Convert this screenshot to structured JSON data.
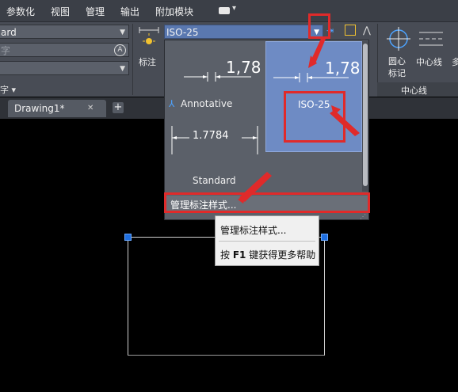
{
  "menubar": {
    "items": [
      "参数化",
      "视图",
      "管理",
      "输出",
      "附加模块"
    ],
    "extra_icon": "video-icon",
    "extra_arrow": "▾"
  },
  "ribbon": {
    "text_style_value": "ard",
    "text_height_placeholder": "字",
    "text_panel_label": "字 ▾",
    "dim_button_label": "标注",
    "dim_style_value": "ISO-25",
    "center_mark_label": "圆心\n标记",
    "centerline_label": "中心线",
    "centerline_panel_label": "中心线",
    "more_label": "多"
  },
  "tabs": {
    "drawing_tab": "Drawing1*",
    "close_glyph": "✕",
    "add_glyph": "+"
  },
  "gallery": {
    "items": [
      {
        "name": "",
        "preview_value": "1,78"
      },
      {
        "name": "ISO-25",
        "preview_value": "1,78",
        "selected": true
      },
      {
        "name": "Annotative",
        "preview_value": ""
      },
      {
        "name": "Standard",
        "preview_value": "1.7784"
      }
    ],
    "manage_label": "管理标注样式..."
  },
  "tooltip": {
    "title": "管理标注样式...",
    "help_prefix": "按 ",
    "help_key": "F1",
    "help_suffix": " 键获得更多帮助"
  },
  "colors": {
    "highlight_red": "#e02a2a",
    "selected_blue": "#6e8bc4",
    "grip_blue": "#1f6fe0"
  }
}
